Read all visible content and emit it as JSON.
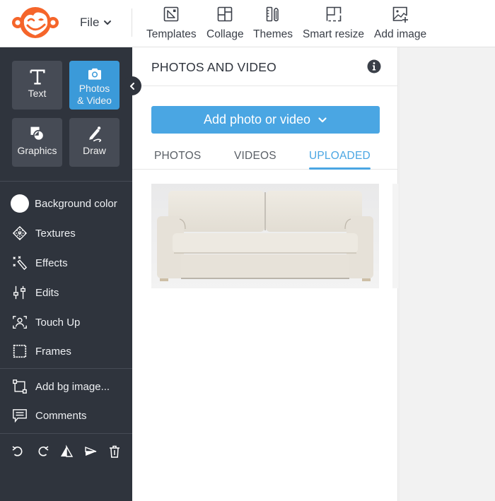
{
  "app": {
    "brand": "PicMonkey",
    "logo_icon": "monkey-logo-icon",
    "brand_color": "#f5652a",
    "accent_color": "#4aa6e3"
  },
  "topbar": {
    "file_menu": {
      "label": "File",
      "icon": "chevron-down-icon"
    },
    "tools": [
      {
        "label": "Templates",
        "icon": "templates-icon"
      },
      {
        "label": "Collage",
        "icon": "collage-icon"
      },
      {
        "label": "Themes",
        "icon": "themes-icon"
      },
      {
        "label": "Smart resize",
        "icon": "smart-resize-icon"
      },
      {
        "label": "Add image",
        "icon": "add-image-icon"
      }
    ]
  },
  "sidebar": {
    "tiles": [
      {
        "label": "Text",
        "icon": "text-icon",
        "active": false
      },
      {
        "label": "Photos & Video",
        "label_line1": "Photos",
        "label_line2": "& Video",
        "icon": "camera-icon",
        "active": true
      },
      {
        "label": "Graphics",
        "icon": "graphics-icon",
        "active": false
      },
      {
        "label": "Draw",
        "icon": "draw-icon",
        "active": false
      }
    ],
    "items": [
      {
        "label": "Background color",
        "icon": "background-color-swatch",
        "swatch_color": "#ffffff"
      },
      {
        "label": "Textures",
        "icon": "textures-icon"
      },
      {
        "label": "Effects",
        "icon": "effects-icon"
      },
      {
        "label": "Edits",
        "icon": "edits-icon"
      },
      {
        "label": "Touch Up",
        "icon": "touch-up-icon"
      },
      {
        "label": "Frames",
        "icon": "frames-icon"
      }
    ],
    "items2": [
      {
        "label": "Add bg image...",
        "icon": "add-bg-image-icon"
      },
      {
        "label": "Comments",
        "icon": "comments-icon"
      }
    ],
    "bottom_actions": [
      {
        "name": "undo",
        "icon": "undo-icon"
      },
      {
        "name": "redo",
        "icon": "redo-icon"
      },
      {
        "name": "flip-horizontal",
        "icon": "flip-horizontal-icon"
      },
      {
        "name": "flip-vertical",
        "icon": "flip-vertical-icon"
      },
      {
        "name": "delete",
        "icon": "trash-icon"
      }
    ]
  },
  "panel": {
    "title": "PHOTOS AND VIDEO",
    "info_icon": "info-icon",
    "add_button": {
      "label": "Add photo or video",
      "icon": "chevron-down-icon"
    },
    "tabs": [
      {
        "label": "PHOTOS",
        "active": false
      },
      {
        "label": "VIDEOS",
        "active": false
      },
      {
        "label": "UPLOADED",
        "active": true
      }
    ],
    "uploaded_items": [
      {
        "description": "Cream upholstered sofa photo"
      }
    ]
  }
}
